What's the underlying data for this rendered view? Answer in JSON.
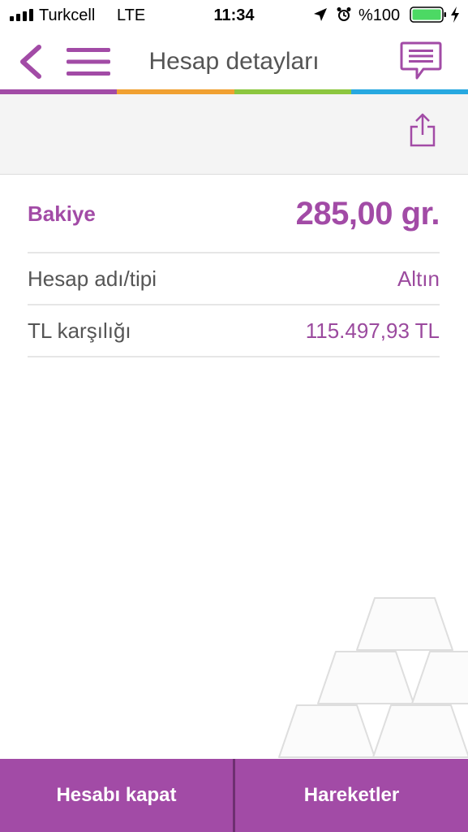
{
  "status_bar": {
    "carrier": "Turkcell",
    "network": "LTE",
    "time": "11:34",
    "battery_percent": "%100",
    "icons": [
      "signal-bars-icon",
      "location-arrow-icon",
      "alarm-clock-icon",
      "battery-icon",
      "charging-bolt-icon"
    ]
  },
  "header": {
    "title": "Hesap detayları",
    "icons": [
      "back-chevron-icon",
      "hamburger-menu-icon",
      "chat-bubble-icon"
    ]
  },
  "color_strip": [
    "#a24ba6",
    "#f0a031",
    "#8cc63f",
    "#27a8e0"
  ],
  "account": {
    "icons": [
      "share-icon"
    ]
  },
  "details": {
    "balance_label": "Bakiye",
    "balance_value": "285,00 gr.",
    "rows": [
      {
        "label": "Hesap adı/tipi",
        "value": "Altın"
      },
      {
        "label": "TL karşılığı",
        "value": "115.497,93 TL"
      }
    ]
  },
  "actions": {
    "close_account": "Hesabı kapat",
    "transactions": "Hareketler"
  },
  "colors": {
    "brand_purple": "#a24ba6",
    "divider": "#6d2f70"
  }
}
